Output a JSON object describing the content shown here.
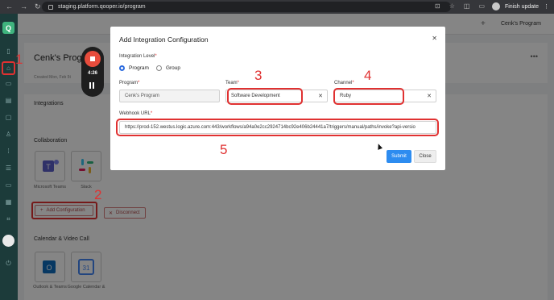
{
  "browser": {
    "url": "staging.platform.qooper.io/program",
    "finish_update": "Finish update"
  },
  "sidebar": {
    "logo_letter": "Q"
  },
  "topbar": {
    "plus": "+",
    "program_selector": "Cenk's Program"
  },
  "page": {
    "title": "Cenk's Prog",
    "created": "Created Mon, Feb 5t",
    "integrations_heading": "Integrations",
    "collaboration_heading": "Collaboration",
    "calendar_heading": "Calendar & Video Call",
    "tiles": [
      {
        "label": "Microsoft Teams"
      },
      {
        "label": "Slack"
      },
      {
        "label": "Outlook & Teams"
      },
      {
        "label": "Google Calendar &"
      }
    ],
    "add_configuration": "Add Configuration",
    "disconnect": "Disconnect"
  },
  "recorder": {
    "time": "4:26"
  },
  "modal": {
    "title": "Add Integration Configuration",
    "integration_level_label": "Integration Level",
    "options": [
      "Program",
      "Group"
    ],
    "program_label": "Program",
    "program_value": "Cenk's Program",
    "team_label": "Team",
    "team_value": "Software Development",
    "channel_label": "Channel",
    "channel_value": "Ruby",
    "webhook_label": "Webhook URL",
    "webhook_value": "https://prod-152.westus.logic.azure.com:443/workflows/a94a0e2cc2924714bc92e406b24441a7/triggers/manual/paths/invoke?api-versio",
    "submit": "Submit",
    "close": "Close"
  },
  "annotations": [
    "1",
    "2",
    "3",
    "4",
    "5"
  ]
}
